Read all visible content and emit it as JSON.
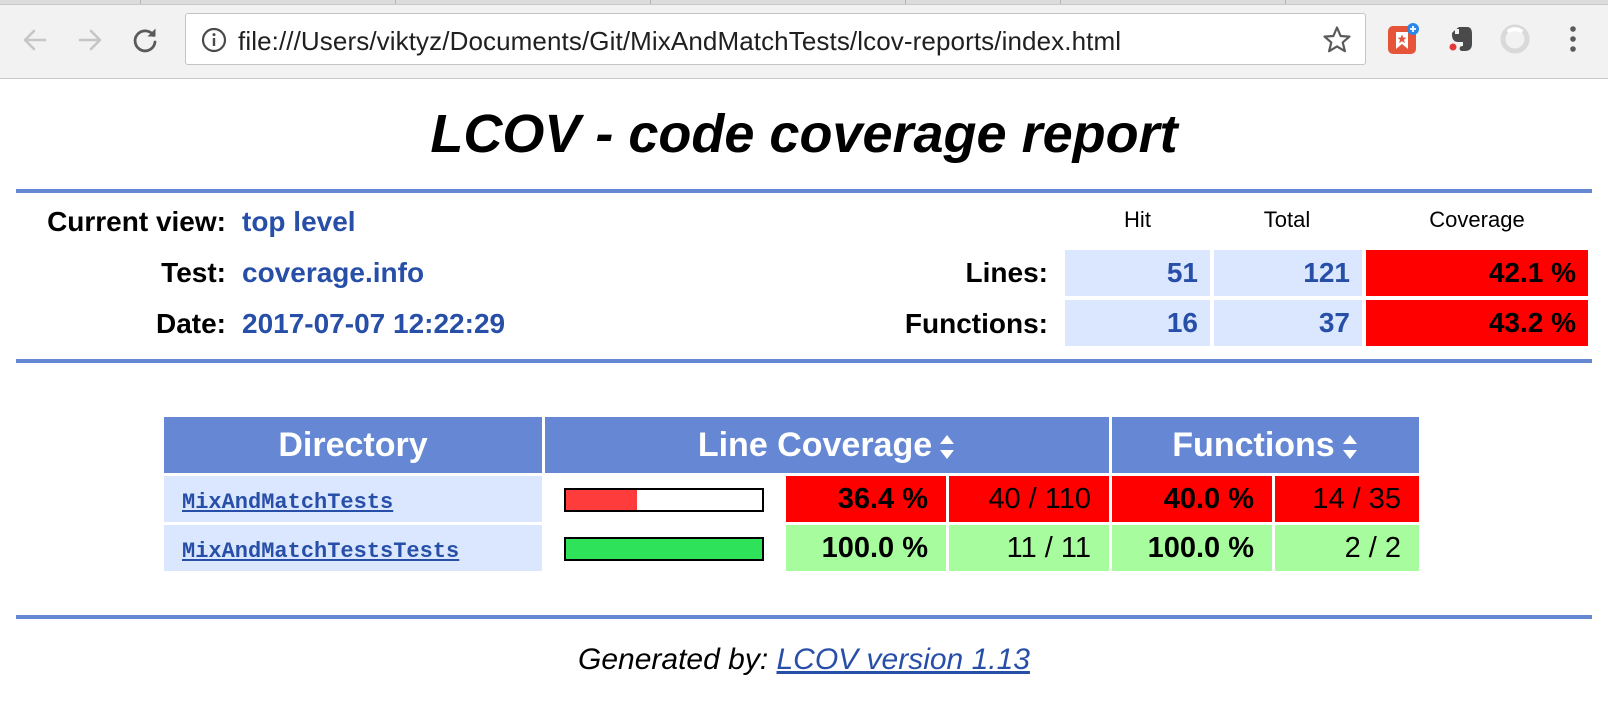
{
  "browser": {
    "url": "file:///Users/viktyz/Documents/Git/MixAndMatchTests/lcov-reports/index.html",
    "icons": {
      "back": "arrow-left-icon",
      "forward": "arrow-right-icon",
      "reload": "reload-icon",
      "info": "info-icon",
      "star": "star-icon",
      "menu": "kebab-menu-icon"
    }
  },
  "report": {
    "title": "LCOV - code coverage report",
    "current_view_label": "Current view:",
    "current_view_value": "top level",
    "test_label": "Test:",
    "test_value": "coverage.info",
    "date_label": "Date:",
    "date_value": "2017-07-07 12:22:29",
    "summary": {
      "headers": [
        "Hit",
        "Total",
        "Coverage"
      ],
      "lines_label": "Lines:",
      "lines": {
        "hit": "51",
        "total": "121",
        "coverage": "42.1 %"
      },
      "functions_label": "Functions:",
      "functions": {
        "hit": "16",
        "total": "37",
        "coverage": "43.2 %"
      }
    }
  },
  "directory_table": {
    "headers": {
      "directory": "Directory",
      "line_coverage": "Line Coverage",
      "functions": "Functions"
    },
    "rows": [
      {
        "name": "MixAndMatchTests",
        "bar_percent": 36.4,
        "line_pct": "36.4 %",
        "line_count": "40 / 110",
        "func_pct": "40.0 %",
        "func_count": "14 / 35"
      },
      {
        "name": "MixAndMatchTestsTests",
        "bar_percent": 100,
        "line_pct": "100.0 %",
        "line_count": "11 / 11",
        "func_pct": "100.0 %",
        "func_count": "2 / 2"
      }
    ]
  },
  "footer": {
    "prefix": "Generated by: ",
    "link": "LCOV version 1.13"
  },
  "colors": {
    "ruler": "#6688d4",
    "link": "#284fa8",
    "low": "#ff0000",
    "high": "#a7fc9d",
    "bar_low": "#ff3c3c",
    "bar_high": "#2ee25a"
  }
}
